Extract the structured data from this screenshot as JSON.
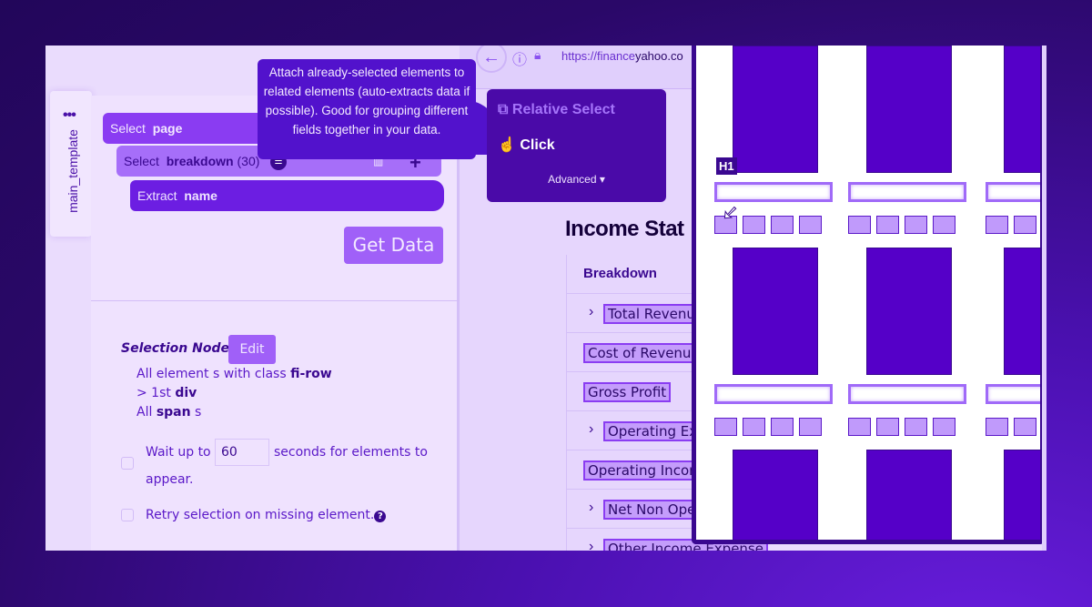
{
  "sidebar": {
    "tab_label": "main_template",
    "menu_icon": "ellipsis-icon"
  },
  "template": {
    "rows": [
      {
        "verb": "Select",
        "target": "page",
        "count": ""
      },
      {
        "verb": "Select",
        "target": "breakdown",
        "count": "(30)"
      },
      {
        "verb": "Extract",
        "target": "name",
        "count": ""
      }
    ],
    "get_data_label": "Get Data"
  },
  "selection": {
    "label": "Selection Node:",
    "edit_label": "Edit",
    "line1_pre": "All element s with class ",
    "line1_bold": "fi-row",
    "line2_pre": "> 1st ",
    "line2_bold": "div",
    "line3_pre": "All ",
    "line3_bold": "span",
    "line3_post": " s",
    "wait_pre": "Wait up to",
    "wait_value": "60",
    "wait_post": "seconds for elements to",
    "wait_post2": "appear.",
    "wait_checked": false,
    "retry_label": "Retry selection on missing element.",
    "retry_checked": false
  },
  "tooltip": {
    "text": "Attach already-selected elements to related elements (auto-extracts data if possible). Good for grouping different fields together in your data."
  },
  "menu": {
    "relative_select": "Relative Select",
    "click": "Click",
    "advanced": "Advanced"
  },
  "browser": {
    "url_pre": "https://finance",
    "url_domain": "yahoo.co",
    "logo": "o.",
    "logo_sub": "ace",
    "heading": "Income Stat",
    "table_header": "Breakdown",
    "rows": [
      {
        "label": "Total Revenu",
        "expandable": true
      },
      {
        "label": "Cost of Revenue",
        "expandable": false
      },
      {
        "label": "Gross Profit",
        "expandable": false
      },
      {
        "label": "Operating Ex",
        "expandable": true
      },
      {
        "label": "Operating Incom",
        "expandable": false
      },
      {
        "label": "Net Non Ope",
        "expandable": true
      },
      {
        "label": "Other Income Expense",
        "expandable": true
      }
    ]
  },
  "overlay": {
    "tag_label": "H1"
  },
  "colors": {
    "accent": "#8a3cf2",
    "dark": "#3a0890",
    "block": "#5500c8",
    "background": "#2a0868"
  }
}
